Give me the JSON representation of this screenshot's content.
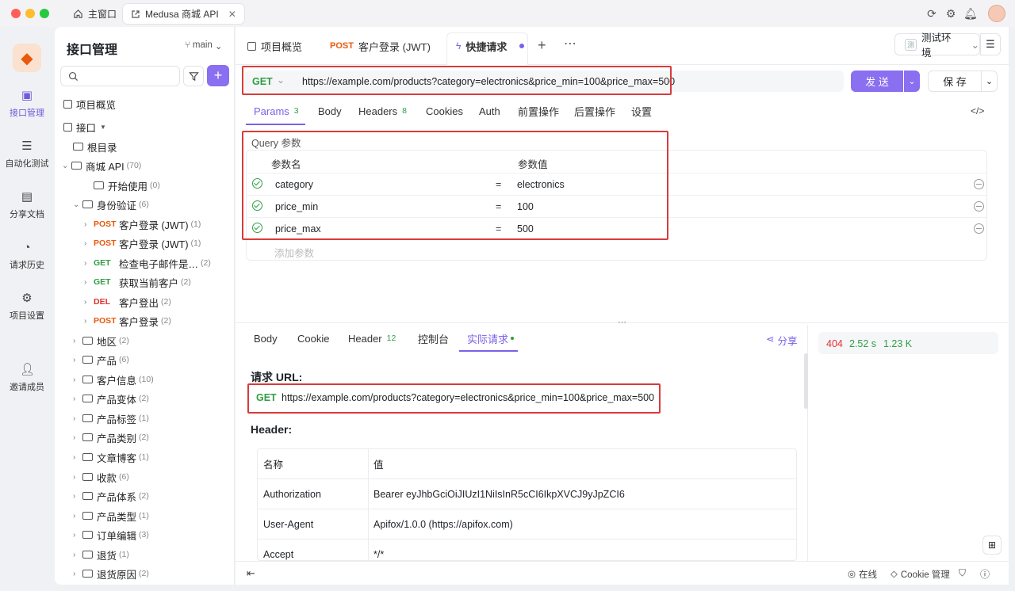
{
  "window": {
    "tabs": [
      {
        "label": "主窗口"
      },
      {
        "label": "Medusa 商城 API"
      }
    ]
  },
  "rail": {
    "items": [
      {
        "label": "接口管理",
        "icon": "api-icon"
      },
      {
        "label": "自动化测试",
        "icon": "automation-icon"
      },
      {
        "label": "分享文档",
        "icon": "share-doc-icon"
      },
      {
        "label": "请求历史",
        "icon": "history-icon"
      },
      {
        "label": "项目设置",
        "icon": "settings-icon"
      },
      {
        "label": "邀请成员",
        "icon": "invite-icon"
      }
    ]
  },
  "tree": {
    "title": "接口管理",
    "branch": "main",
    "overview": "项目概览",
    "interfaces": "接口",
    "root": "根目录",
    "nodes": [
      {
        "label": "商城 API",
        "count": "(70)"
      },
      {
        "label": "开始使用",
        "count": "(0)"
      },
      {
        "label": "身份验证",
        "count": "(6)"
      },
      {
        "method": "POST",
        "label": "客户登录 (JWT)",
        "count": "(1)"
      },
      {
        "method": "POST",
        "label": "客户登录 (JWT)",
        "count": "(1)"
      },
      {
        "method": "GET",
        "label": "检查电子邮件是…",
        "count": "(2)"
      },
      {
        "method": "GET",
        "label": "获取当前客户",
        "count": "(2)"
      },
      {
        "method": "DEL",
        "label": "客户登出",
        "count": "(2)"
      },
      {
        "method": "POST",
        "label": "客户登录",
        "count": "(2)"
      },
      {
        "label": "地区",
        "count": "(2)"
      },
      {
        "label": "产品",
        "count": "(6)"
      },
      {
        "label": "客户信息",
        "count": "(10)"
      },
      {
        "label": "产品变体",
        "count": "(2)"
      },
      {
        "label": "产品标签",
        "count": "(1)"
      },
      {
        "label": "产品类别",
        "count": "(2)"
      },
      {
        "label": "文章博客",
        "count": "(1)"
      },
      {
        "label": "收款",
        "count": "(6)"
      },
      {
        "label": "产品体系",
        "count": "(2)"
      },
      {
        "label": "产品类型",
        "count": "(1)"
      },
      {
        "label": "订单编辑",
        "count": "(3)"
      },
      {
        "label": "退货",
        "count": "(1)"
      },
      {
        "label": "退货原因",
        "count": "(2)"
      }
    ]
  },
  "tabs": {
    "overview": "项目概览",
    "post_method": "POST",
    "post_label": "客户登录 (JWT)",
    "quick": "快捷请求",
    "env": "测试环境"
  },
  "request": {
    "method": "GET",
    "url": "https://example.com/products?category=electronics&price_min=100&price_max=500",
    "send": "发 送",
    "save": "保 存"
  },
  "subtabs": [
    {
      "label": "Params",
      "badge": "3"
    },
    {
      "label": "Body"
    },
    {
      "label": "Headers",
      "badge": "8"
    },
    {
      "label": "Cookies"
    },
    {
      "label": "Auth"
    },
    {
      "label": "前置操作"
    },
    {
      "label": "后置操作"
    },
    {
      "label": "设置"
    }
  ],
  "query": {
    "title": "Query 参数",
    "col_name": "参数名",
    "col_value": "参数值",
    "rows": [
      {
        "name": "category",
        "eq": "=",
        "value": "electronics"
      },
      {
        "name": "price_min",
        "eq": "=",
        "value": "100"
      },
      {
        "name": "price_max",
        "eq": "=",
        "value": "500"
      }
    ],
    "add_placeholder": "添加参数"
  },
  "response": {
    "tabs": [
      {
        "label": "Body"
      },
      {
        "label": "Cookie"
      },
      {
        "label": "Header",
        "badge": "12"
      },
      {
        "label": "控制台"
      },
      {
        "label": "实际请求"
      }
    ],
    "share": "分享",
    "status": "404",
    "time": "2.52 s",
    "size": "1.23 K",
    "url_heading": "请求 URL:",
    "method": "GET",
    "url": "https://example.com/products?category=electronics&price_min=100&price_max=500",
    "header_heading": "Header:",
    "header_cols": {
      "name": "名称",
      "value": "值"
    },
    "headers": [
      {
        "name": "Authorization",
        "value": "Bearer eyJhbGciOiJIUzI1NiIsInR5cCI6IkpXVCJ9yJpZCI6"
      },
      {
        "name": "User-Agent",
        "value": "Apifox/1.0.0 (https://apifox.com)"
      },
      {
        "name": "Accept",
        "value": "*/*"
      }
    ]
  },
  "statusbar": {
    "online": "在线",
    "cookie": "Cookie 管理"
  },
  "colors": {
    "accent": "#7b61e8",
    "get": "#2f9e44",
    "post": "#e8590c",
    "highlight": "#d93b3b"
  }
}
